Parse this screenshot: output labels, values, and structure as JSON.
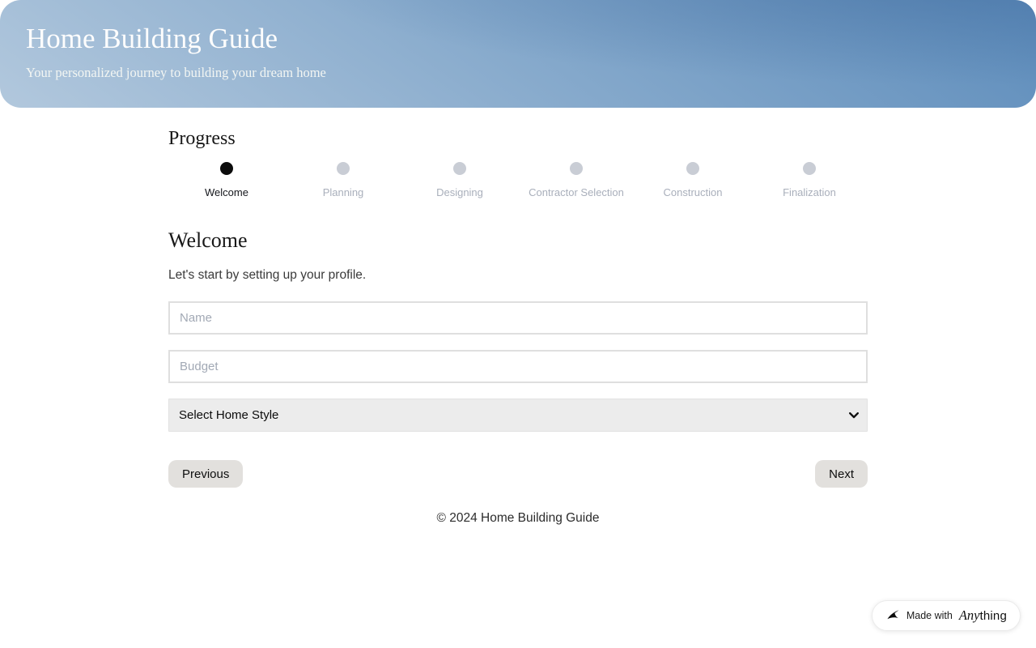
{
  "header": {
    "title": "Home Building Guide",
    "subtitle": "Your personalized journey to building your dream home"
  },
  "progress": {
    "heading": "Progress",
    "steps": [
      {
        "label": "Welcome",
        "active": true
      },
      {
        "label": "Planning",
        "active": false
      },
      {
        "label": "Designing",
        "active": false
      },
      {
        "label": "Contractor Selection",
        "active": false
      },
      {
        "label": "Construction",
        "active": false
      },
      {
        "label": "Finalization",
        "active": false
      }
    ]
  },
  "welcome": {
    "heading": "Welcome",
    "description": "Let's start by setting up your profile."
  },
  "form": {
    "name_placeholder": "Name",
    "budget_placeholder": "Budget",
    "home_style_selected": "Select Home Style"
  },
  "nav": {
    "previous_label": "Previous",
    "next_label": "Next"
  },
  "footer": {
    "copyright": "© 2024 Home Building Guide"
  },
  "badge": {
    "made_with": "Made with",
    "brand_italic": "Any",
    "brand_rest": "thing"
  },
  "colors": {
    "header_gradient_dark": "#5d8cbb",
    "header_gradient_light": "#b2c8dd",
    "active_step": "#0c0c0c",
    "inactive_step": "#c9cdd5",
    "inactive_label": "#a9afbb",
    "input_border": "#dfdfdf",
    "select_bg": "#ececec",
    "button_bg": "#e2e0dd"
  }
}
